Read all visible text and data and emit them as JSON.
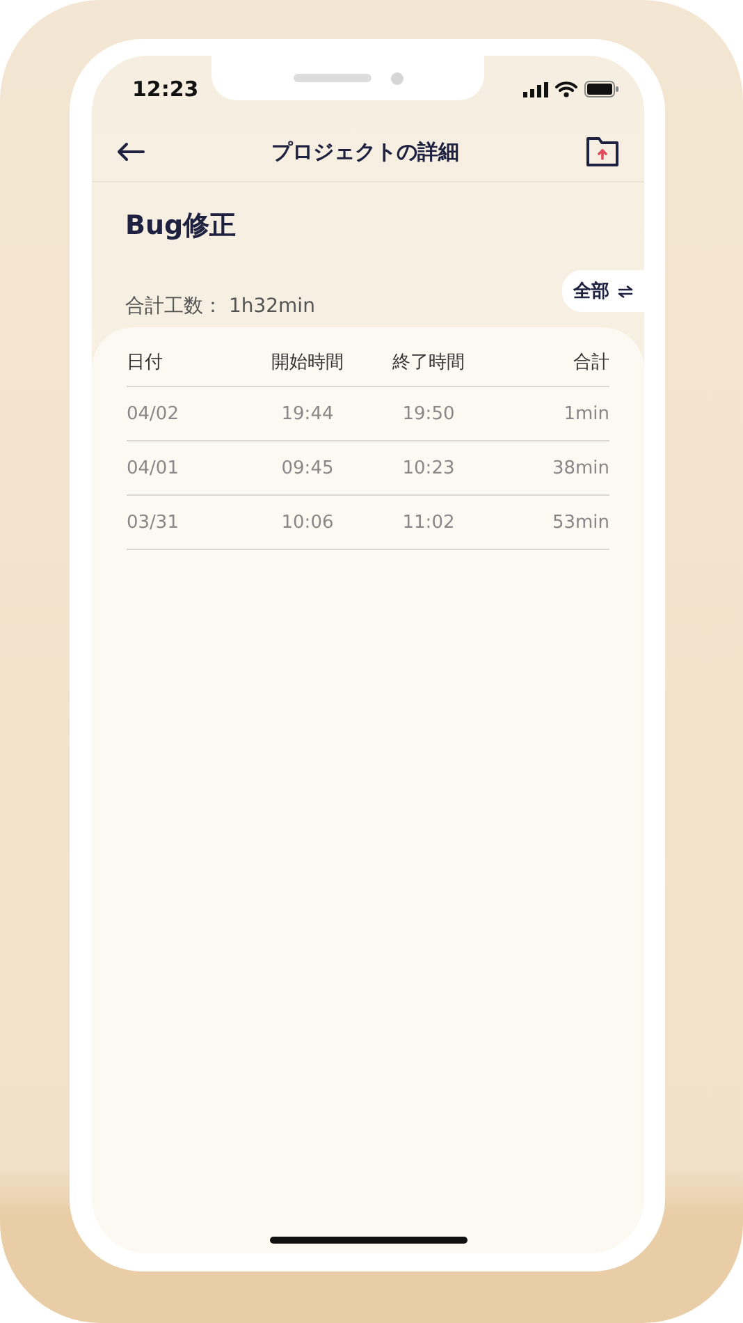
{
  "status_bar": {
    "time": "12:23"
  },
  "header": {
    "title": "プロジェクトの詳細"
  },
  "project": {
    "name": "Bug修正",
    "total": "合計工数： 1h32min",
    "filter": "全部"
  },
  "table": {
    "columns": [
      "日付",
      "開始時間",
      "終了時間",
      "合計"
    ],
    "rows": [
      [
        "04/02",
        "19:44",
        "19:50",
        "1min"
      ],
      [
        "04/01",
        "09:45",
        "10:23",
        "38min"
      ],
      [
        "03/31",
        "10:06",
        "11:02",
        "53min"
      ]
    ]
  }
}
